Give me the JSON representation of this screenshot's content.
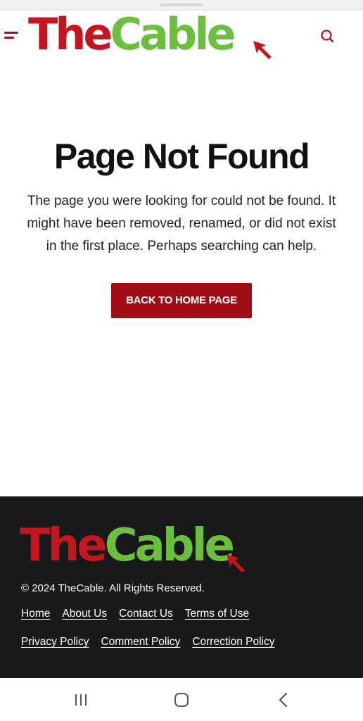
{
  "header": {
    "logo": {
      "part1": "The",
      "part2": "Cable"
    },
    "menu_icon": "hamburger-icon",
    "search_icon": "search-icon"
  },
  "main": {
    "title": "Page Not Found",
    "message": "The page you were looking for could not be found. It might have been removed, renamed, or did not exist in the first place. Perhaps searching can help.",
    "button_label": "BACK TO HOME PAGE"
  },
  "footer": {
    "logo": {
      "part1": "The",
      "part2": "Cable"
    },
    "copyright": "© 2024 TheCable. All Rights Reserved.",
    "links_row1": [
      "Home",
      "About Us",
      "Contact Us",
      "Terms of Use"
    ],
    "links_row2": [
      "Privacy Policy",
      "Comment Policy",
      "Correction Policy"
    ]
  },
  "nav_bar": {
    "icons": [
      "recents-icon",
      "home-icon",
      "back-icon"
    ]
  },
  "colors": {
    "brand_red": "#c3161f",
    "brand_green": "#6cbe3f",
    "button_red": "#a00d14",
    "footer_bg": "#191919"
  }
}
